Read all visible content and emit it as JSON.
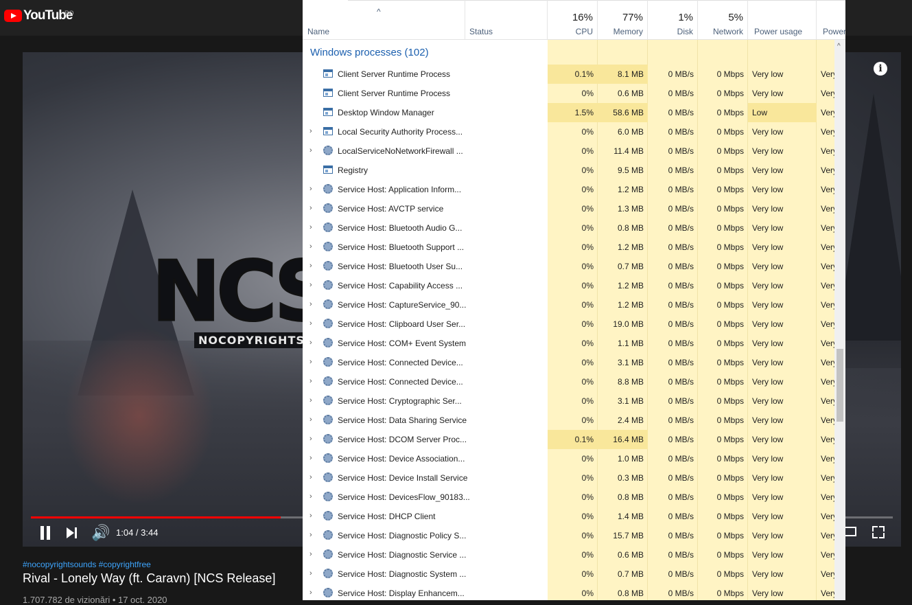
{
  "youtube": {
    "logo_text": "YouTube",
    "country": "RO",
    "video": {
      "logo_text": "NCS",
      "logo_sub": "NOCOPYRIGHTSO",
      "info_icon": "i",
      "time": "1:04 / 3:44",
      "progress_fraction": 0.29
    },
    "tags": "#nocopyrightsounds #copyrightfree",
    "title": "Rival - Lonely Way (ft. Caravn) [NCS Release]",
    "views": "1.707.782 de vizionări • 17 oct. 2020"
  },
  "taskmanager": {
    "headers": {
      "name": "Name",
      "status": "Status",
      "cpu": {
        "pct": "16%",
        "label": "CPU"
      },
      "memory": {
        "pct": "77%",
        "label": "Memory"
      },
      "disk": {
        "pct": "1%",
        "label": "Disk"
      },
      "network": {
        "pct": "5%",
        "label": "Network"
      },
      "power": "Power usage",
      "power_trend": "Power"
    },
    "group": "Windows processes (102)",
    "rows": [
      {
        "name": "Client Server Runtime Process",
        "icon": "window-icon",
        "expand": false,
        "cpu": "0.1%",
        "mem": "8.1 MB",
        "disk": "0 MB/s",
        "net": "0 Mbps",
        "power": "Very low",
        "trend": "Very"
      },
      {
        "name": "Client Server Runtime Process",
        "icon": "window-icon",
        "expand": false,
        "cpu": "0%",
        "mem": "0.6 MB",
        "disk": "0 MB/s",
        "net": "0 Mbps",
        "power": "Very low",
        "trend": "Very"
      },
      {
        "name": "Desktop Window Manager",
        "icon": "window-icon",
        "expand": false,
        "cpu": "1.5%",
        "mem": "58.6 MB",
        "disk": "0 MB/s",
        "net": "0 Mbps",
        "power": "Low",
        "trend": "Very"
      },
      {
        "name": "Local Security Authority Process...",
        "icon": "window-icon",
        "expand": true,
        "cpu": "0%",
        "mem": "6.0 MB",
        "disk": "0 MB/s",
        "net": "0 Mbps",
        "power": "Very low",
        "trend": "Very"
      },
      {
        "name": "LocalServiceNoNetworkFirewall ...",
        "icon": "gear-icon",
        "expand": true,
        "cpu": "0%",
        "mem": "11.4 MB",
        "disk": "0 MB/s",
        "net": "0 Mbps",
        "power": "Very low",
        "trend": "Very"
      },
      {
        "name": "Registry",
        "icon": "window-icon",
        "expand": false,
        "cpu": "0%",
        "mem": "9.5 MB",
        "disk": "0 MB/s",
        "net": "0 Mbps",
        "power": "Very low",
        "trend": "Very"
      },
      {
        "name": "Service Host: Application Inform...",
        "icon": "gear-icon",
        "expand": true,
        "cpu": "0%",
        "mem": "1.2 MB",
        "disk": "0 MB/s",
        "net": "0 Mbps",
        "power": "Very low",
        "trend": "Very"
      },
      {
        "name": "Service Host: AVCTP service",
        "icon": "gear-icon",
        "expand": true,
        "cpu": "0%",
        "mem": "1.3 MB",
        "disk": "0 MB/s",
        "net": "0 Mbps",
        "power": "Very low",
        "trend": "Very"
      },
      {
        "name": "Service Host: Bluetooth Audio G...",
        "icon": "gear-icon",
        "expand": true,
        "cpu": "0%",
        "mem": "0.8 MB",
        "disk": "0 MB/s",
        "net": "0 Mbps",
        "power": "Very low",
        "trend": "Very"
      },
      {
        "name": "Service Host: Bluetooth Support ...",
        "icon": "gear-icon",
        "expand": true,
        "cpu": "0%",
        "mem": "1.2 MB",
        "disk": "0 MB/s",
        "net": "0 Mbps",
        "power": "Very low",
        "trend": "Very"
      },
      {
        "name": "Service Host: Bluetooth User Su...",
        "icon": "gear-icon",
        "expand": true,
        "cpu": "0%",
        "mem": "0.7 MB",
        "disk": "0 MB/s",
        "net": "0 Mbps",
        "power": "Very low",
        "trend": "Very"
      },
      {
        "name": "Service Host: Capability Access ...",
        "icon": "gear-icon",
        "expand": true,
        "cpu": "0%",
        "mem": "1.2 MB",
        "disk": "0 MB/s",
        "net": "0 Mbps",
        "power": "Very low",
        "trend": "Very"
      },
      {
        "name": "Service Host: CaptureService_90...",
        "icon": "gear-icon",
        "expand": true,
        "cpu": "0%",
        "mem": "1.2 MB",
        "disk": "0 MB/s",
        "net": "0 Mbps",
        "power": "Very low",
        "trend": "Very"
      },
      {
        "name": "Service Host: Clipboard User Ser...",
        "icon": "gear-icon",
        "expand": true,
        "cpu": "0%",
        "mem": "19.0 MB",
        "disk": "0 MB/s",
        "net": "0 Mbps",
        "power": "Very low",
        "trend": "Very"
      },
      {
        "name": "Service Host: COM+ Event System",
        "icon": "gear-icon",
        "expand": true,
        "cpu": "0%",
        "mem": "1.1 MB",
        "disk": "0 MB/s",
        "net": "0 Mbps",
        "power": "Very low",
        "trend": "Very"
      },
      {
        "name": "Service Host: Connected Device...",
        "icon": "gear-icon",
        "expand": true,
        "cpu": "0%",
        "mem": "3.1 MB",
        "disk": "0 MB/s",
        "net": "0 Mbps",
        "power": "Very low",
        "trend": "Very"
      },
      {
        "name": "Service Host: Connected Device...",
        "icon": "gear-icon",
        "expand": true,
        "cpu": "0%",
        "mem": "8.8 MB",
        "disk": "0 MB/s",
        "net": "0 Mbps",
        "power": "Very low",
        "trend": "Very"
      },
      {
        "name": "Service Host: Cryptographic Ser...",
        "icon": "gear-icon",
        "expand": true,
        "cpu": "0%",
        "mem": "3.1 MB",
        "disk": "0 MB/s",
        "net": "0 Mbps",
        "power": "Very low",
        "trend": "Very"
      },
      {
        "name": "Service Host: Data Sharing Service",
        "icon": "gear-icon",
        "expand": true,
        "cpu": "0%",
        "mem": "2.4 MB",
        "disk": "0 MB/s",
        "net": "0 Mbps",
        "power": "Very low",
        "trend": "Very"
      },
      {
        "name": "Service Host: DCOM Server Proc...",
        "icon": "gear-icon",
        "expand": true,
        "cpu": "0.1%",
        "mem": "16.4 MB",
        "disk": "0 MB/s",
        "net": "0 Mbps",
        "power": "Very low",
        "trend": "Very"
      },
      {
        "name": "Service Host: Device Association...",
        "icon": "gear-icon",
        "expand": true,
        "cpu": "0%",
        "mem": "1.0 MB",
        "disk": "0 MB/s",
        "net": "0 Mbps",
        "power": "Very low",
        "trend": "Very"
      },
      {
        "name": "Service Host: Device Install Service",
        "icon": "gear-icon",
        "expand": true,
        "cpu": "0%",
        "mem": "0.3 MB",
        "disk": "0 MB/s",
        "net": "0 Mbps",
        "power": "Very low",
        "trend": "Very"
      },
      {
        "name": "Service Host: DevicesFlow_90183...",
        "icon": "gear-icon",
        "expand": true,
        "cpu": "0%",
        "mem": "0.8 MB",
        "disk": "0 MB/s",
        "net": "0 Mbps",
        "power": "Very low",
        "trend": "Very"
      },
      {
        "name": "Service Host: DHCP Client",
        "icon": "gear-icon",
        "expand": true,
        "cpu": "0%",
        "mem": "1.4 MB",
        "disk": "0 MB/s",
        "net": "0 Mbps",
        "power": "Very low",
        "trend": "Very"
      },
      {
        "name": "Service Host: Diagnostic Policy S...",
        "icon": "gear-icon",
        "expand": true,
        "cpu": "0%",
        "mem": "15.7 MB",
        "disk": "0 MB/s",
        "net": "0 Mbps",
        "power": "Very low",
        "trend": "Very"
      },
      {
        "name": "Service Host: Diagnostic Service ...",
        "icon": "gear-icon",
        "expand": true,
        "cpu": "0%",
        "mem": "0.6 MB",
        "disk": "0 MB/s",
        "net": "0 Mbps",
        "power": "Very low",
        "trend": "Very"
      },
      {
        "name": "Service Host: Diagnostic System ...",
        "icon": "gear-icon",
        "expand": true,
        "cpu": "0%",
        "mem": "0.7 MB",
        "disk": "0 MB/s",
        "net": "0 Mbps",
        "power": "Very low",
        "trend": "Very"
      },
      {
        "name": "Service Host: Display Enhancem...",
        "icon": "gear-icon",
        "expand": true,
        "cpu": "0%",
        "mem": "0.8 MB",
        "disk": "0 MB/s",
        "net": "0 Mbps",
        "power": "Very low",
        "trend": "Very"
      }
    ]
  }
}
